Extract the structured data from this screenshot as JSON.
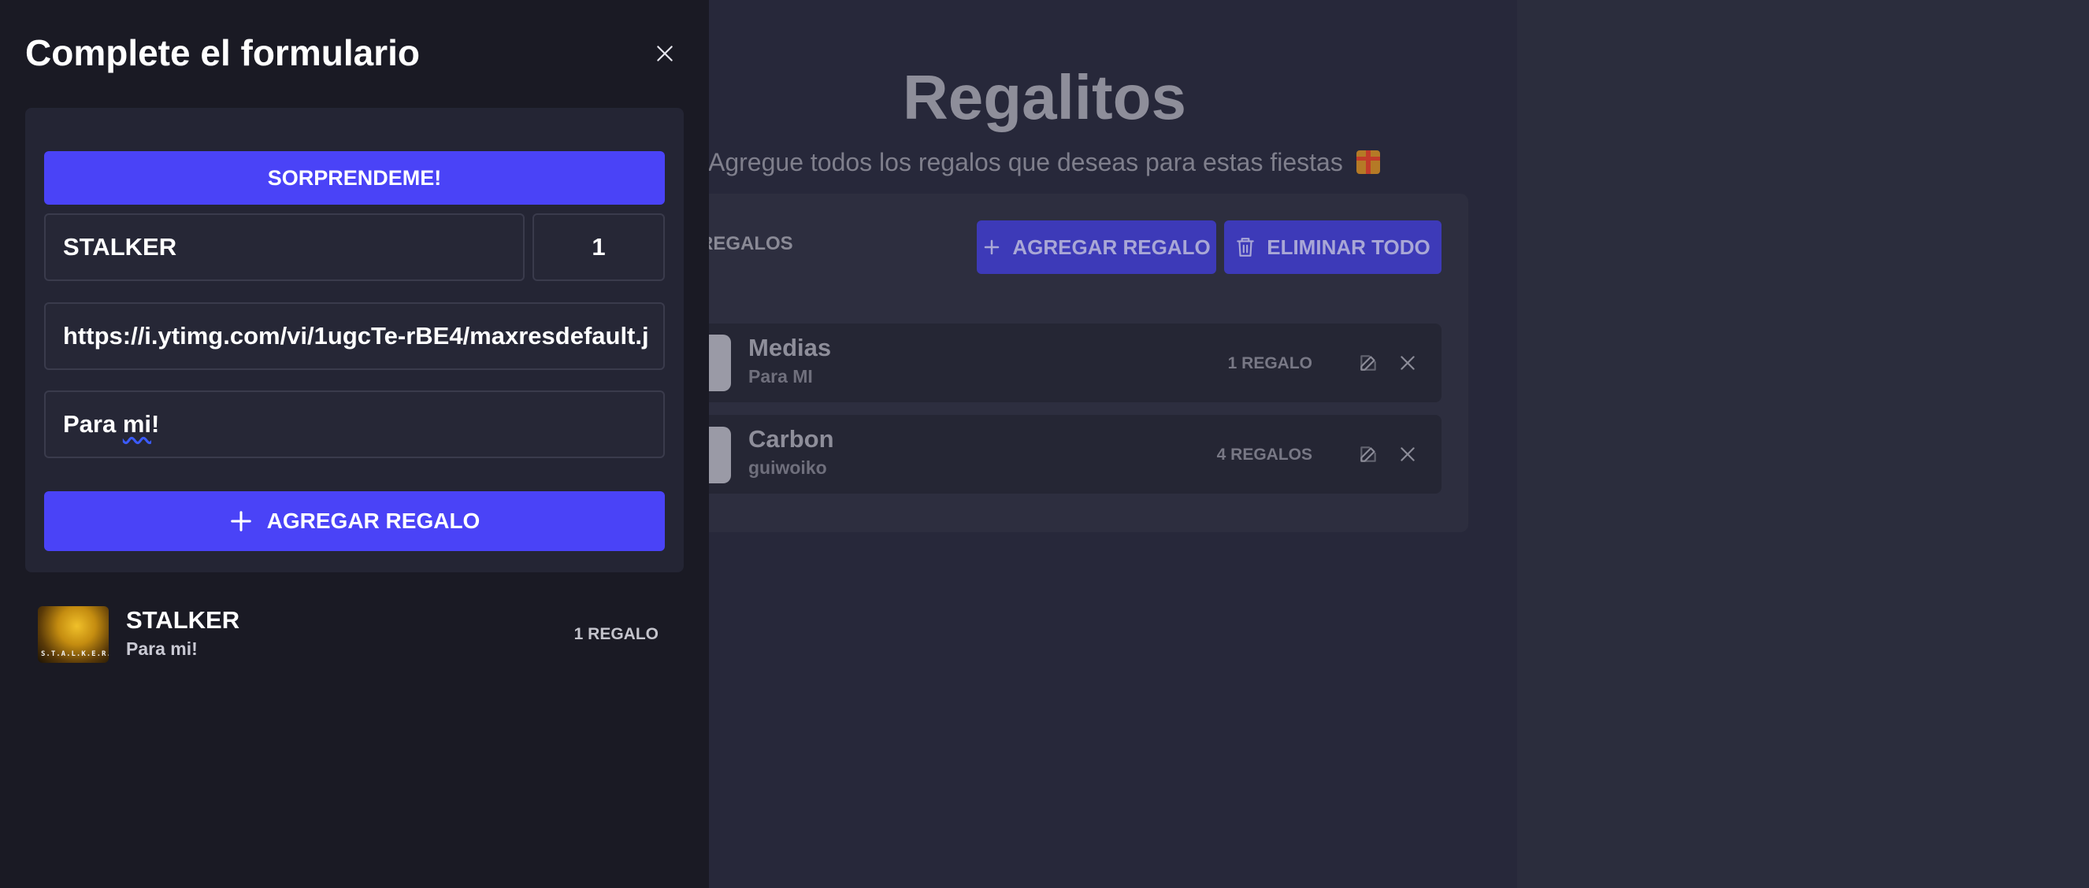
{
  "background_app": {
    "title": "Regalitos",
    "subtitle": "Agregue todos los regalos que deseas para estas fiestas",
    "regalos_label": "REGALOS",
    "add_button_label": "AGREGAR REGALO",
    "delete_all_label": "ELIMINAR TODO",
    "gifts": [
      {
        "name": "Medias",
        "to": "Para MI",
        "qty": "1 REGALO"
      },
      {
        "name": "Carbon",
        "to": "guiwoiko",
        "qty": "4 REGALOS"
      }
    ]
  },
  "drawer": {
    "title": "Complete el formulario",
    "surprise_button": "SORPRENDEME!",
    "name_value": "STALKER",
    "qty_value": "1",
    "image_url_value": "https://i.ytimg.com/vi/1ugcTe-rBE4/maxresdefault.j",
    "recipient_prefix": "Para ",
    "recipient_misspelled": "mi",
    "recipient_suffix": "!",
    "add_button_label": "AGREGAR REGALO",
    "list": [
      {
        "name": "STALKER",
        "to": "Para mi!",
        "qty": "1 REGALO",
        "thumb_text": "S.T.A.L.K.E.R."
      }
    ]
  },
  "colors": {
    "accent": "#4a43f7",
    "drawer_bg": "#1a1a24",
    "card_bg": "#242534"
  },
  "icons": [
    "close-icon",
    "plus-icon",
    "trash-icon",
    "edit-icon",
    "gift-emoji"
  ]
}
